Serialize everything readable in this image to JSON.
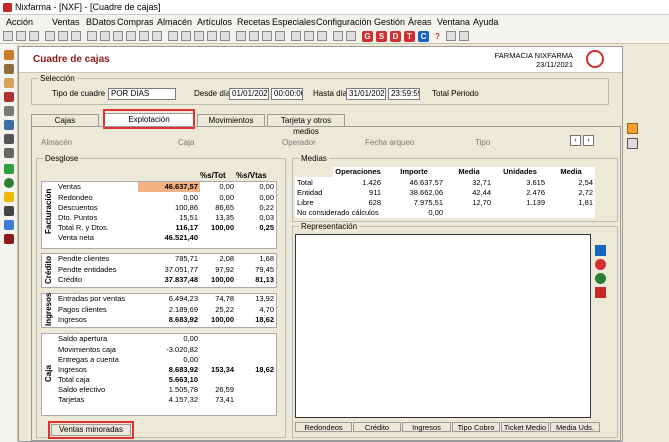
{
  "app_title": "Nixfarma - [NXF] - [Cuadre de cajas]",
  "menu": [
    "Acción",
    "Ventas",
    "BDatos",
    "Compras",
    "Almacén",
    "Artículos",
    "Recetas",
    "Especiales",
    "Configuración",
    "Gestión",
    "Áreas",
    "Ventana",
    "Ayuda"
  ],
  "toolbar_letters": [
    "G",
    "S",
    "D",
    "T",
    "C",
    "?"
  ],
  "page_title": "Cuadre de cajas",
  "pharmacy": {
    "name": "FARMACIA NIXFARMA",
    "date": "23/11/2021"
  },
  "seleccion": {
    "legend": "Selección",
    "tipo_label": "Tipo de cuadre",
    "tipo_value": "POR DIAS",
    "desde_label": "Desde día",
    "desde_date": "01/01/2021",
    "desde_time": "00:00:00",
    "hasta_label": "Hasta día",
    "hasta_date": "31/01/2021",
    "hasta_time": "23:59:59",
    "total_label": "Total Periodo"
  },
  "tabs": [
    "Cajas",
    "Explotación",
    "Movimientos",
    "Tarjeta y otros medios"
  ],
  "filters": {
    "almacen": "Almacén",
    "caja": "Caja",
    "operador": "Operador",
    "fecha": "Fecha arqueo",
    "tipo": "Tipo"
  },
  "desglose": {
    "legend": "Desglose",
    "headers": [
      "%s/Tot",
      "%s/Vtas"
    ],
    "facturacion": {
      "label": "Facturación",
      "rows": [
        [
          "Ventas",
          "46.637,57",
          "0,00",
          "0,00"
        ],
        [
          "Redondeo",
          "0,00",
          "0,00",
          "0,00"
        ],
        [
          "Descuentos",
          "100,86",
          "86,65",
          "0,22"
        ],
        [
          "Dto. Puntos",
          "15,51",
          "13,35",
          "0,03"
        ],
        [
          "Total R. y Dtos.",
          "116,17",
          "100,00",
          "0,25"
        ],
        [
          "Venta neta",
          "46.521,40",
          "",
          ""
        ]
      ]
    },
    "credito": {
      "label": "Crédito",
      "rows": [
        [
          "Pendte clientes",
          "785,71",
          "2,08",
          "1,68"
        ],
        [
          "Pendte entidades",
          "37.051,77",
          "97,92",
          "79,45"
        ],
        [
          "Crédito",
          "37.837,48",
          "100,00",
          "81,13"
        ]
      ]
    },
    "ingresos": {
      "label": "Ingresos",
      "rows": [
        [
          "Entradas por ventas",
          "6.494,23",
          "74,78",
          "13,92"
        ],
        [
          "Pagos clientes",
          "2.189,69",
          "25,22",
          "4,70"
        ],
        [
          "Ingresos",
          "8.683,92",
          "100,00",
          "18,62"
        ]
      ]
    },
    "caja": {
      "label": "Caja",
      "rows": [
        [
          "Saldo apertura",
          "0,00",
          "",
          ""
        ],
        [
          "Movimientos caja",
          "-3.020,82",
          "",
          ""
        ],
        [
          "Entregas a cuenta",
          "0,00",
          "",
          ""
        ],
        [
          "Ingresos",
          "8.683,92",
          "153,34",
          "18,62"
        ],
        [
          "Total caja",
          "5.663,10",
          "",
          ""
        ],
        [
          "Saldo efectivo",
          "1.505,78",
          "26,59",
          ""
        ],
        [
          "Tarjetas",
          "4.157,32",
          "73,41",
          ""
        ]
      ]
    },
    "ventas_minoradas": "Ventas minoradas"
  },
  "medias": {
    "legend": "Medias",
    "headers": [
      "Operaciones",
      "Importe",
      "Media",
      "Unidades",
      "Media"
    ],
    "rows": [
      [
        "Total",
        "1.426",
        "46.637,57",
        "32,71",
        "3.615",
        "2,54"
      ],
      [
        "Entidad",
        "911",
        "38.662,06",
        "42,44",
        "2.476",
        "2,72"
      ],
      [
        "Libre",
        "628",
        "7.975,51",
        "12,70",
        "1.139",
        "1,81"
      ],
      [
        "No considerado cálculos",
        "",
        "0,00",
        "",
        "",
        ""
      ]
    ]
  },
  "representacion": {
    "legend": "Representación",
    "buttons": [
      "Redondeos",
      "Crédito",
      "Ingresos",
      "Tipo Cobro",
      "Ticket Medio",
      "Media Uds."
    ]
  }
}
